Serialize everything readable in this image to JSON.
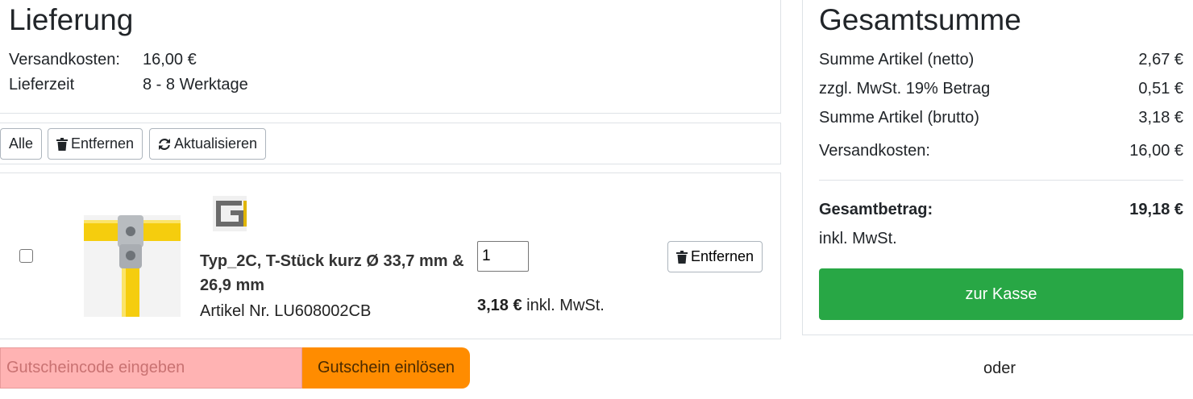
{
  "delivery": {
    "title": "Lieferung",
    "shipping_label": "Versandkosten:",
    "shipping_value": "16,00 €",
    "time_label": "Lieferzeit",
    "time_value": "8 - 8 Werktage"
  },
  "toolbar": {
    "all_label": "Alle",
    "remove_label": "Entfernen",
    "update_label": "Aktualisieren"
  },
  "item": {
    "title": "Typ_2C, T-Stück kurz Ø 33,7 mm & 26,9 mm",
    "sku": "Artikel Nr. LU608002CB",
    "quantity": "1",
    "price": "3,18 €",
    "price_suffix": " inkl. MwSt.",
    "remove_label": "Entfernen",
    "checked": false
  },
  "voucher": {
    "placeholder": "Gutscheincode eingeben",
    "button_label": "Gutschein einlösen"
  },
  "summary": {
    "title": "Gesamtsumme",
    "rows": [
      {
        "label": "Summe Artikel (netto)",
        "value": "2,67 €"
      },
      {
        "label": "zzgl. MwSt. 19% Betrag",
        "value": "0,51 €"
      },
      {
        "label": "Summe Artikel (brutto)",
        "value": "3,18 €"
      },
      {
        "label": "Versandkosten:",
        "value": "16,00 €"
      }
    ],
    "total_label": "Gesamtbetrag:",
    "total_value": "19,18 €",
    "tax_note": "inkl. MwSt.",
    "checkout_label": "zur Kasse",
    "or_label": "oder"
  },
  "colors": {
    "checkout": "#28a745",
    "voucher_button": "#ff8c00",
    "voucher_input": "#ffb3b3",
    "product_yellow": "#f5cd0e"
  },
  "icons": [
    "trash-icon",
    "refresh-icon",
    "brand-logo"
  ]
}
